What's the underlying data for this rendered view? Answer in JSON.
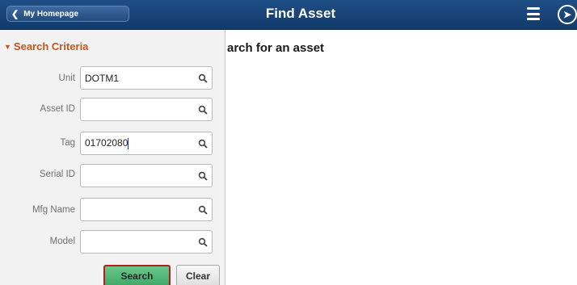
{
  "header": {
    "home_label": "My Homepage",
    "title": "Find Asset",
    "menu_icon": "hamburger-menu-icon",
    "nav_icon": "navbar-compass-icon"
  },
  "main": {
    "heading": "arch for an asset"
  },
  "search_criteria": {
    "title": "Search Criteria",
    "fields": [
      {
        "label": "Unit",
        "value": "DOTM1"
      },
      {
        "label": "Asset ID",
        "value": ""
      },
      {
        "label": "Tag",
        "value": "01702080"
      },
      {
        "label": "Serial ID",
        "value": ""
      },
      {
        "label": "Mfg Name",
        "value": ""
      },
      {
        "label": "Model",
        "value": ""
      }
    ],
    "search_button": "Search",
    "clear_button": "Clear"
  },
  "colors": {
    "header_bg": "#1a4578",
    "section_title": "#c0551e",
    "search_button": "#4bb370",
    "search_border": "#b01e1e"
  }
}
